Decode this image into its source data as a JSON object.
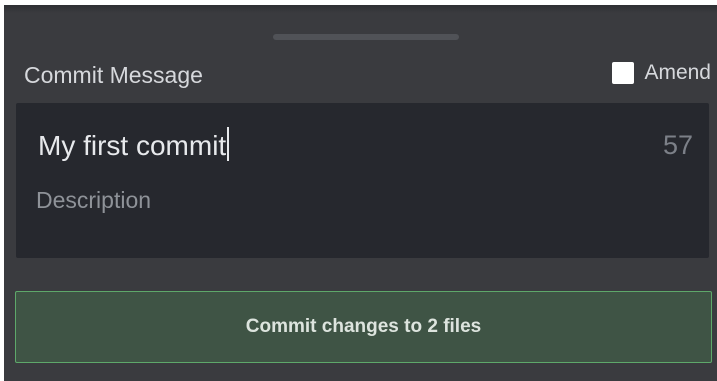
{
  "commit_panel": {
    "title": "Commit Message",
    "amend": {
      "label": "Amend",
      "checked": false
    },
    "summary": {
      "value": "My first commit",
      "remaining_chars": "57"
    },
    "description": {
      "placeholder": "Description"
    },
    "commit_button": {
      "label": "Commit changes to 2 files"
    }
  },
  "colors": {
    "panel_bg": "#3a3b3f",
    "editor_bg": "#26282e",
    "button_bg": "#3f5445",
    "button_border": "#5ea86a"
  }
}
